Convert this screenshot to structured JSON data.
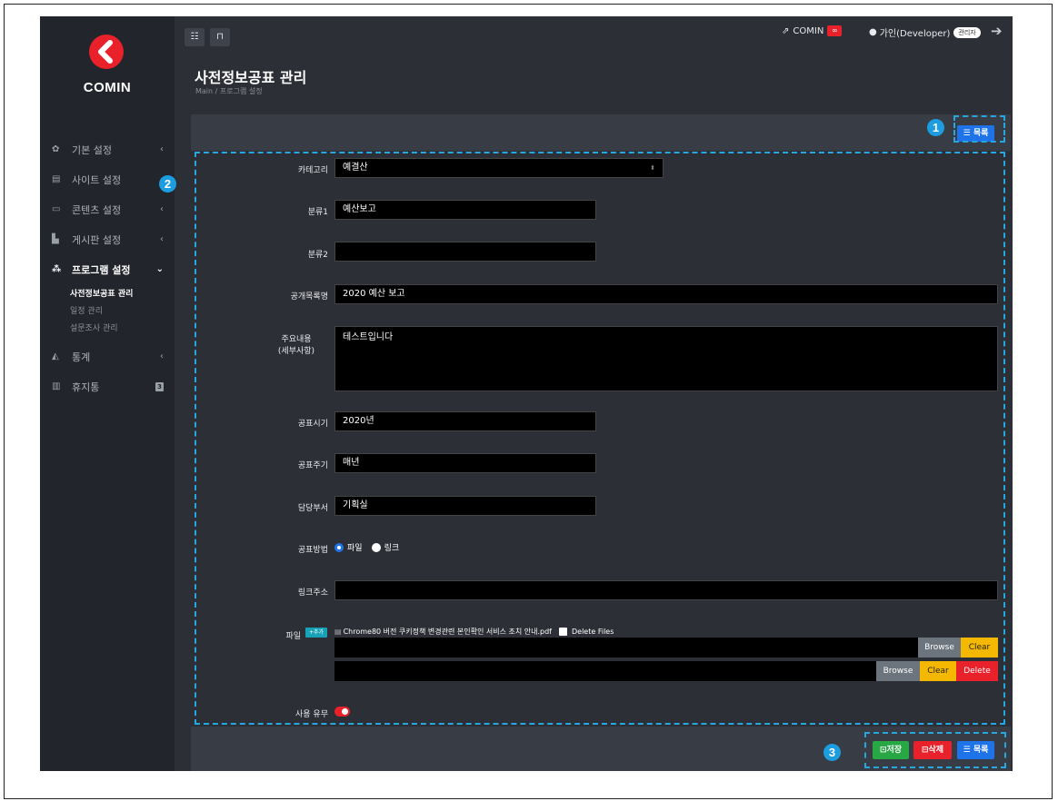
{
  "app": {
    "brand": "COMIN"
  },
  "sidebar": {
    "items": [
      {
        "label": "기본 설정"
      },
      {
        "label": "사이트 설정"
      },
      {
        "label": "콘텐츠 설정"
      },
      {
        "label": "게시판 설정"
      },
      {
        "label": "프로그램 설정"
      },
      {
        "label": "통계"
      },
      {
        "label": "휴지통",
        "badge": "3"
      }
    ],
    "subitems": [
      {
        "label": "사전정보공표 관리"
      },
      {
        "label": "일정 관리"
      },
      {
        "label": "설문조사 관리"
      }
    ]
  },
  "header": {
    "site_label": "COMIN",
    "user_label": "가인(Developer)",
    "role_badge": "관리자"
  },
  "page": {
    "title": "사전정보공표 관리",
    "breadcrumb": "Main  /  프로그램 설정"
  },
  "toolbar": {
    "list_label": "목록",
    "save_label": "저장",
    "delete_label": "삭제"
  },
  "form": {
    "category": {
      "label": "카테고리",
      "value": "예결산"
    },
    "class1": {
      "label": "분류1",
      "value": "예산보고"
    },
    "class2": {
      "label": "분류2",
      "value": ""
    },
    "item_name": {
      "label": "공개목록명",
      "value": "2020 예산 보고"
    },
    "content": {
      "label1": "주요내용",
      "label2": "(세부사항)",
      "value": "테스트입니다"
    },
    "period": {
      "label": "공표시기",
      "value": "2020년"
    },
    "cycle": {
      "label": "공표주기",
      "value": "매년"
    },
    "dept": {
      "label": "담당부서",
      "value": "기획실"
    },
    "method": {
      "label": "공표방법",
      "options": [
        "파일",
        "링크"
      ],
      "selected": "파일"
    },
    "link": {
      "label": "링크주소",
      "value": ""
    },
    "file": {
      "label": "파일",
      "add_label": "+추가",
      "filename": "Chrome80 버전 쿠키정책 변경관련 본인확인 서비스 조치 안내.pdf",
      "delete_files_label": "Delete Files",
      "browse_label": "Browse",
      "clear_label": "Clear",
      "delete_label": "Delete"
    },
    "use": {
      "label": "사용 유무",
      "enabled": true
    }
  },
  "annotations": [
    "1",
    "2",
    "3"
  ],
  "colors": {
    "accent": "#1e73e8",
    "brand": "#e8212b",
    "annotation": "#27a7df",
    "save": "#28a745",
    "delete": "#e8212b",
    "clear": "#f5b800"
  }
}
